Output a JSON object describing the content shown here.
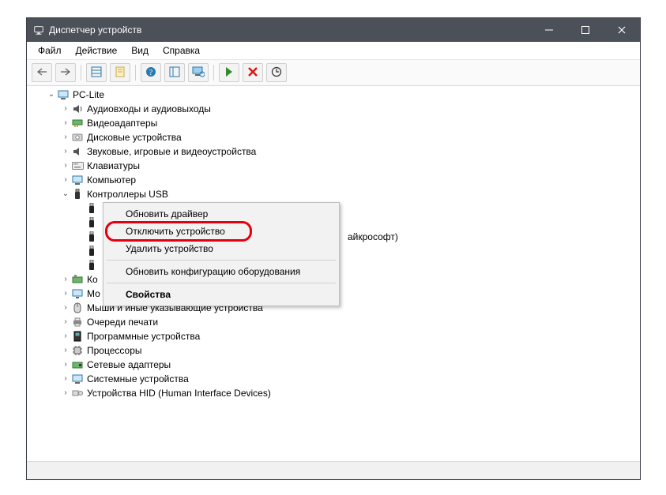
{
  "window": {
    "title": "Диспетчер устройств"
  },
  "menubar": {
    "file": "Файл",
    "action": "Действие",
    "view": "Вид",
    "help": "Справка"
  },
  "tree": {
    "root": "PC-Lite",
    "categories": {
      "audio": "Аудиовходы и аудиовыходы",
      "display": "Видеоадаптеры",
      "disk": "Дисковые устройства",
      "sound": "Звуковые, игровые и видеоустройства",
      "keyboard": "Клавиатуры",
      "computer": "Компьютер",
      "usb": "Контроллеры USB",
      "usb_child_visible": "айкрософт)",
      "storage": "Ко",
      "monitors": "Мо",
      "mice": "Мыши и иные указывающие устройства",
      "printq": "Очереди печати",
      "software": "Программные устройства",
      "cpu": "Процессоры",
      "net": "Сетевые адаптеры",
      "system": "Системные устройства",
      "hid": "Устройства HID (Human Interface Devices)"
    }
  },
  "context_menu": {
    "update_driver": "Обновить драйвер",
    "disable_device": "Отключить устройство",
    "uninstall_device": "Удалить устройство",
    "scan_hardware": "Обновить конфигурацию оборудования",
    "properties": "Свойства"
  }
}
